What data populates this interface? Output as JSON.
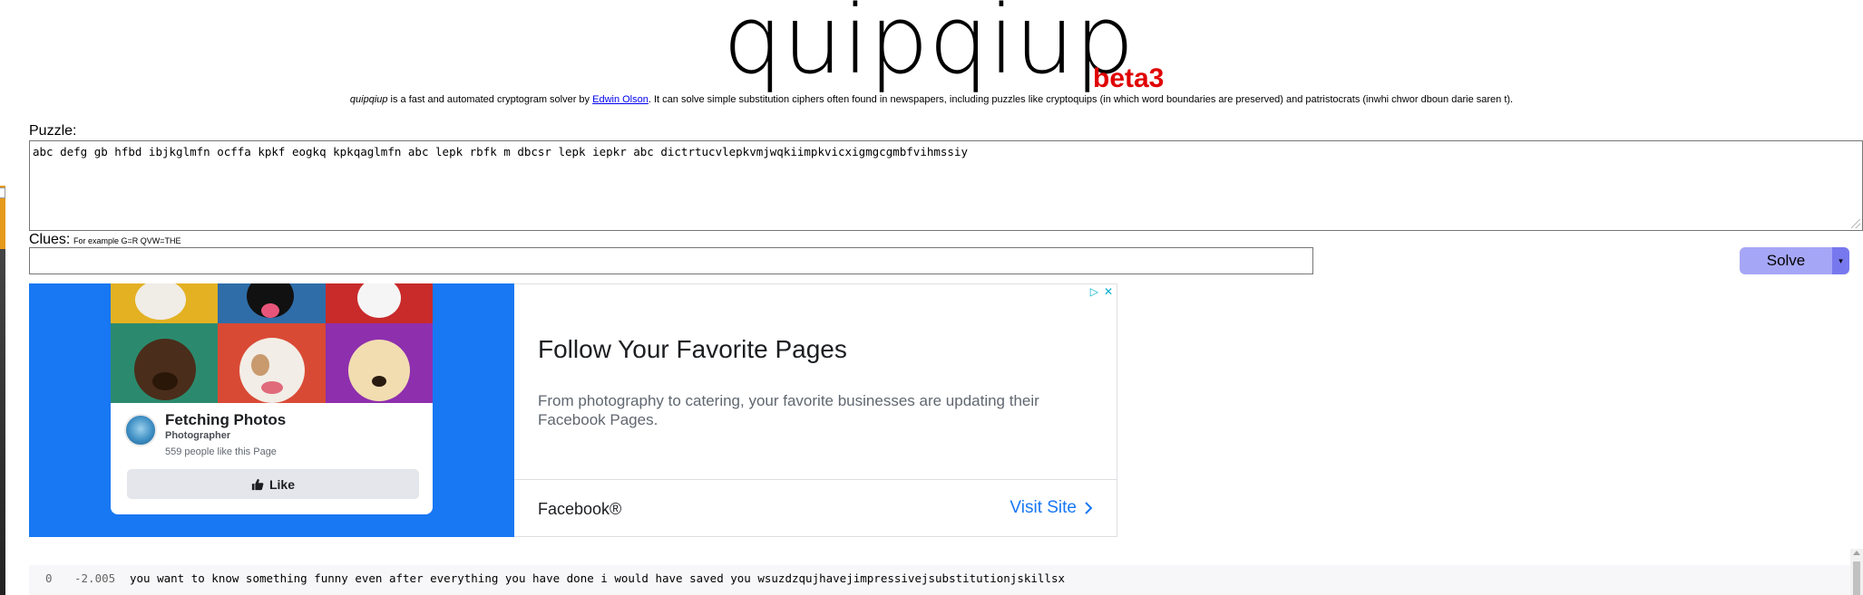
{
  "header": {
    "logo": "quipqiup",
    "version": "beta3",
    "desc_name": "quipqiup",
    "desc_part1": " is a fast and automated cryptogram solver by ",
    "author_link": "Edwin Olson",
    "desc_part2": ". It can solve simple substitution ciphers often found in newspapers, including puzzles like cryptoquips (in which word boundaries are preserved) and patristocrats (inwhi chwor dboun darie saren t)."
  },
  "puzzle": {
    "label": "Puzzle:",
    "value": "abc defg gb hfbd ibjkglmfn ocffa kpkf eogkq kpkqaglmfn abc lepk rbfk m dbcsr lepk iepkr abc dictrtucvlepkvmjwqkiimpkvicxigmgcgmbfvihmssiy"
  },
  "clues": {
    "label": "Clues:",
    "hint": "For example G=R QVW=THE",
    "value": ""
  },
  "solve": {
    "label": "Solve",
    "dropdown_glyph": "▾"
  },
  "ad": {
    "page_name": "Fetching Photos",
    "page_category": "Photographer",
    "page_likes": "559 people like this Page",
    "like_label": "Like",
    "headline": "Follow Your Favorite Pages",
    "body": "From photography to catering, your favorite businesses are updating their Facebook Pages.",
    "brand": "Facebook®",
    "cta": "Visit Site",
    "adchoices_icons": [
      "play-triangle-icon",
      "close-x-icon"
    ],
    "accent_color": "#1877f2"
  },
  "results": [
    {
      "index": "0",
      "score": "-2.005",
      "text": "you want to know something funny even after everything you have done i would have saved you wsuzdzqujhavejimpressivejsubstitutionjskillsx"
    }
  ]
}
